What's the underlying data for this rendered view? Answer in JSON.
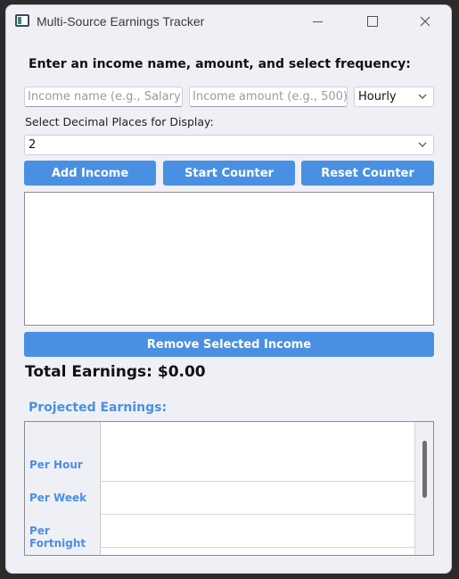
{
  "window": {
    "title": "Multi-Source Earnings Tracker",
    "icon": "app-window-icon",
    "controls": [
      "minimize-icon",
      "maximize-icon",
      "close-icon"
    ]
  },
  "form": {
    "heading": "Enter an income name, amount, and select frequency:",
    "name_placeholder": "Income name (e.g., Salary)",
    "name_value": "",
    "amount_placeholder": "Income amount (e.g., 500)",
    "amount_value": "",
    "frequency_selected": "Hourly",
    "decimal_label": "Select Decimal Places for Display:",
    "decimal_selected": "2"
  },
  "buttons": {
    "add": "Add Income",
    "start": "Start Counter",
    "reset": "Reset Counter",
    "remove": "Remove Selected Income"
  },
  "income_list": {
    "items": []
  },
  "total": {
    "text": "Total Earnings: $0.00"
  },
  "projected": {
    "heading": "Projected Earnings:",
    "rows": [
      {
        "label": "Per Hour",
        "value": ""
      },
      {
        "label": "Per Week",
        "value": ""
      },
      {
        "label": "Per Fortnight",
        "value": ""
      }
    ]
  },
  "colors": {
    "accent": "#4a90e2",
    "window_bg": "#eff0f5",
    "text": "#111111"
  }
}
